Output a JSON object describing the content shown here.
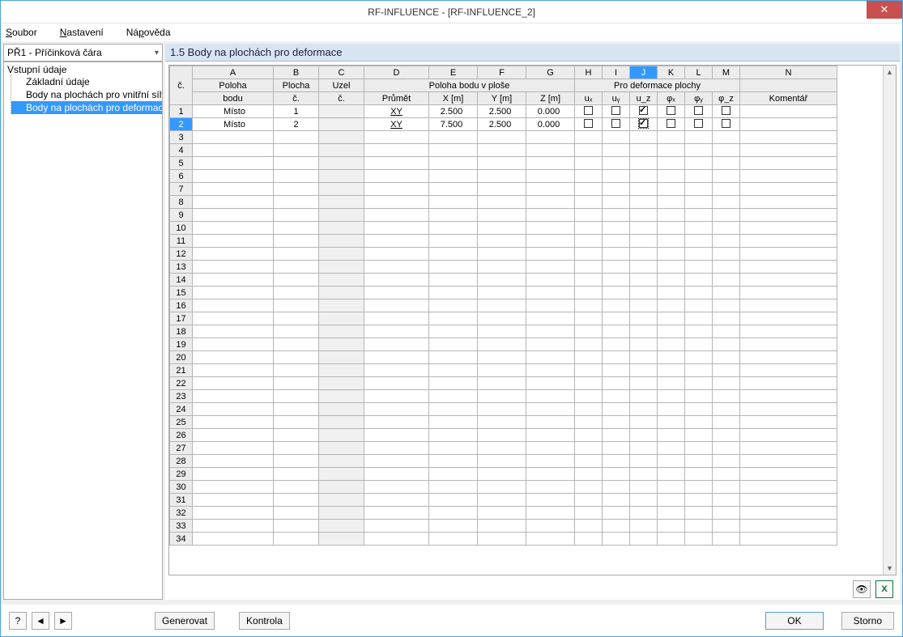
{
  "window": {
    "title": "RF-INFLUENCE - [RF-INFLUENCE_2]"
  },
  "menu": {
    "file": "Soubor",
    "settings": "Nastavení",
    "help": "Nápověda"
  },
  "combo": {
    "value": "PŘ1 - Příčinková čára"
  },
  "tree": {
    "root": "Vstupní údaje",
    "items": [
      "Základní údaje",
      "Body na plochách pro vnitřní síly",
      "Body na plochách pro deformace"
    ]
  },
  "panel": {
    "title": "1.5 Body na plochách pro deformace"
  },
  "grid": {
    "letters": [
      "A",
      "B",
      "C",
      "D",
      "E",
      "F",
      "G",
      "H",
      "I",
      "J",
      "K",
      "L",
      "M",
      "N"
    ],
    "group_row": {
      "rownum": "č.",
      "poloha_bodu": "Poloha",
      "plocha": "Plocha",
      "uzel": "Uzel",
      "poloha_v_plose": "Poloha bodu v ploše",
      "deformace": "Pro deformace plochy",
      "komentar": ""
    },
    "header_row": {
      "poloha_bodu": "bodu",
      "plocha": "č.",
      "uzel": "č.",
      "prumet": "Průmět",
      "x": "X [m]",
      "y": "Y [m]",
      "z": "Z [m]",
      "ux": "uₓ",
      "uy": "uᵧ",
      "uz": "u_z",
      "phix": "φₓ",
      "phiy": "φᵧ",
      "phiz": "φ_z",
      "komentar": "Komentář"
    },
    "rows": [
      {
        "n": "1",
        "poloha": "Místo",
        "plocha": "1",
        "uzel": "",
        "prumet": "XY",
        "x": "2.500",
        "y": "2.500",
        "z": "0.000",
        "ux": false,
        "uy": false,
        "uz": true,
        "phix": false,
        "phiy": false,
        "phiz": false,
        "k": ""
      },
      {
        "n": "2",
        "poloha": "Místo",
        "plocha": "2",
        "uzel": "",
        "prumet": "XY",
        "x": "7.500",
        "y": "2.500",
        "z": "0.000",
        "ux": false,
        "uy": false,
        "uz": true,
        "phix": false,
        "phiy": false,
        "phiz": false,
        "k": ""
      }
    ],
    "empty_count": 32,
    "selected_row": 2,
    "selected_col": "J"
  },
  "footer": {
    "generate": "Generovat",
    "check": "Kontrola",
    "ok": "OK",
    "cancel": "Storno"
  }
}
